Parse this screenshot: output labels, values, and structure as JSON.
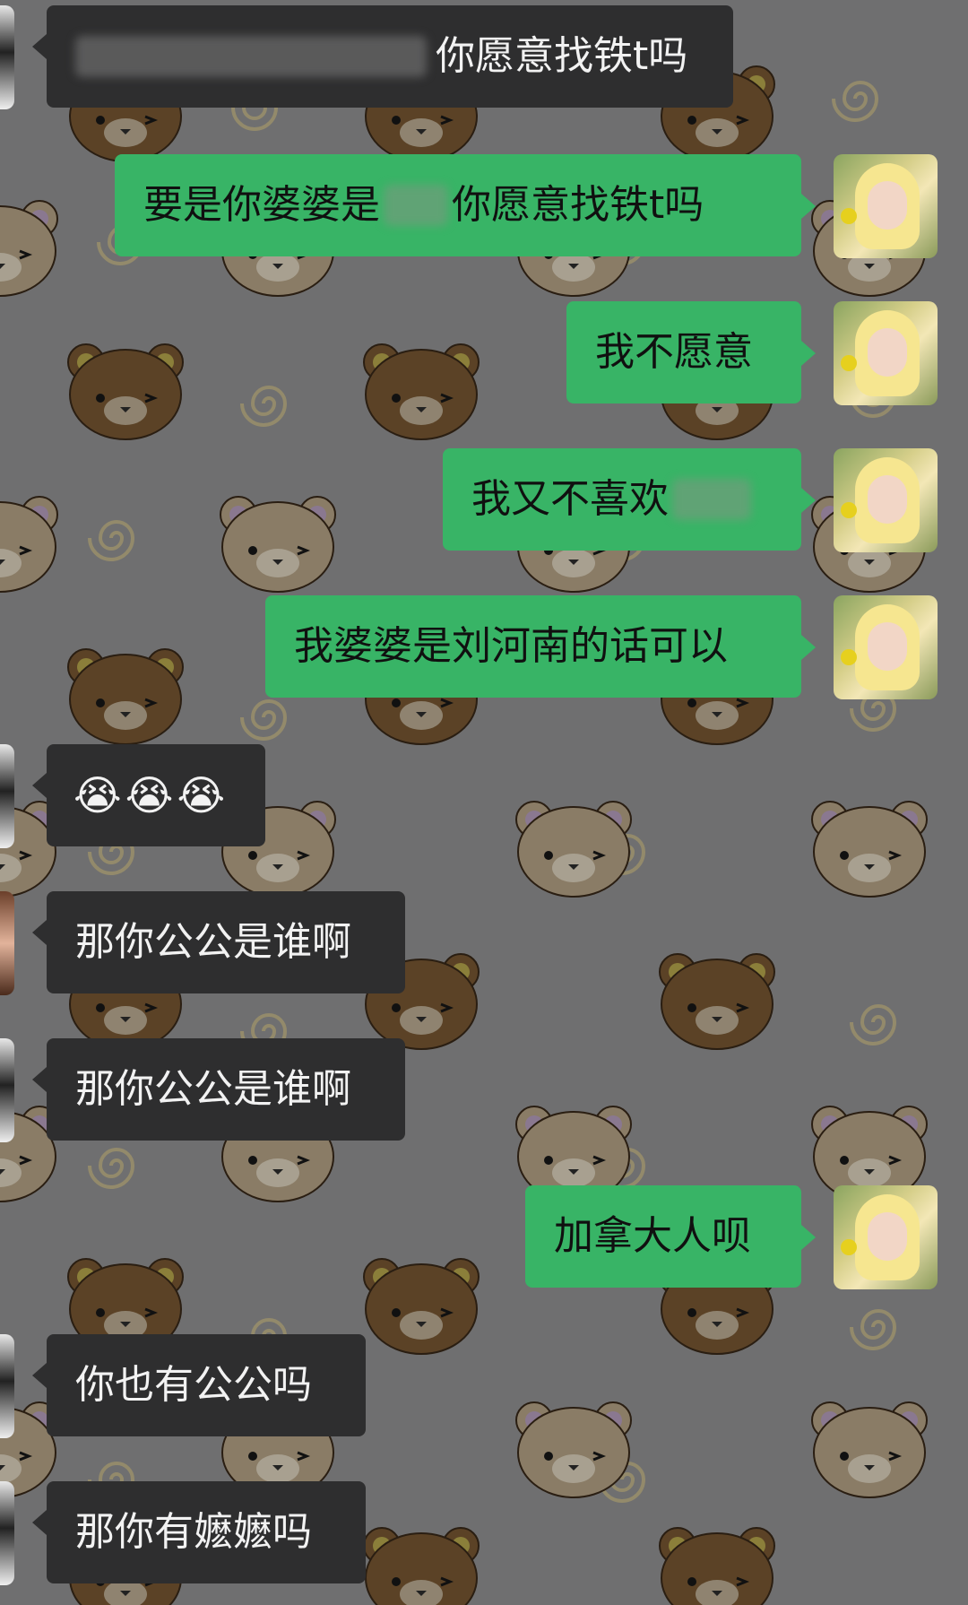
{
  "colors": {
    "background": "#6f6f70",
    "incoming_bubble": "#2e2e2f",
    "outgoing_bubble": "#38b466",
    "incoming_text": "#f2f2f2",
    "outgoing_text": "#101010"
  },
  "messages": [
    {
      "id": "m1",
      "sender": "them",
      "text": "你愿意找铁t吗",
      "partially_obscured": true
    },
    {
      "id": "m2",
      "sender": "me",
      "text_before": "要是你婆婆是",
      "text_after": "你愿意找铁t吗",
      "partially_obscured": true
    },
    {
      "id": "m3",
      "sender": "me",
      "text": "我不愿意"
    },
    {
      "id": "m4",
      "sender": "me",
      "text": "我又不喜欢",
      "partially_obscured": true
    },
    {
      "id": "m5",
      "sender": "me",
      "text": "我婆婆是刘河南的话可以"
    },
    {
      "id": "m6",
      "sender": "them",
      "emoji": [
        "😭",
        "😭",
        "😭"
      ]
    },
    {
      "id": "m7",
      "sender": "them",
      "text": "那你公公是谁啊"
    },
    {
      "id": "m8",
      "sender": "them",
      "text": "那你公公是谁啊"
    },
    {
      "id": "m9",
      "sender": "me",
      "text": "加拿大人呗"
    },
    {
      "id": "m10",
      "sender": "them",
      "text": "你也有公公吗"
    },
    {
      "id": "m11",
      "sender": "them",
      "text": "那你有嬷嬷吗"
    }
  ],
  "wallpaper": {
    "pattern": "bear-face-and-spiral"
  }
}
